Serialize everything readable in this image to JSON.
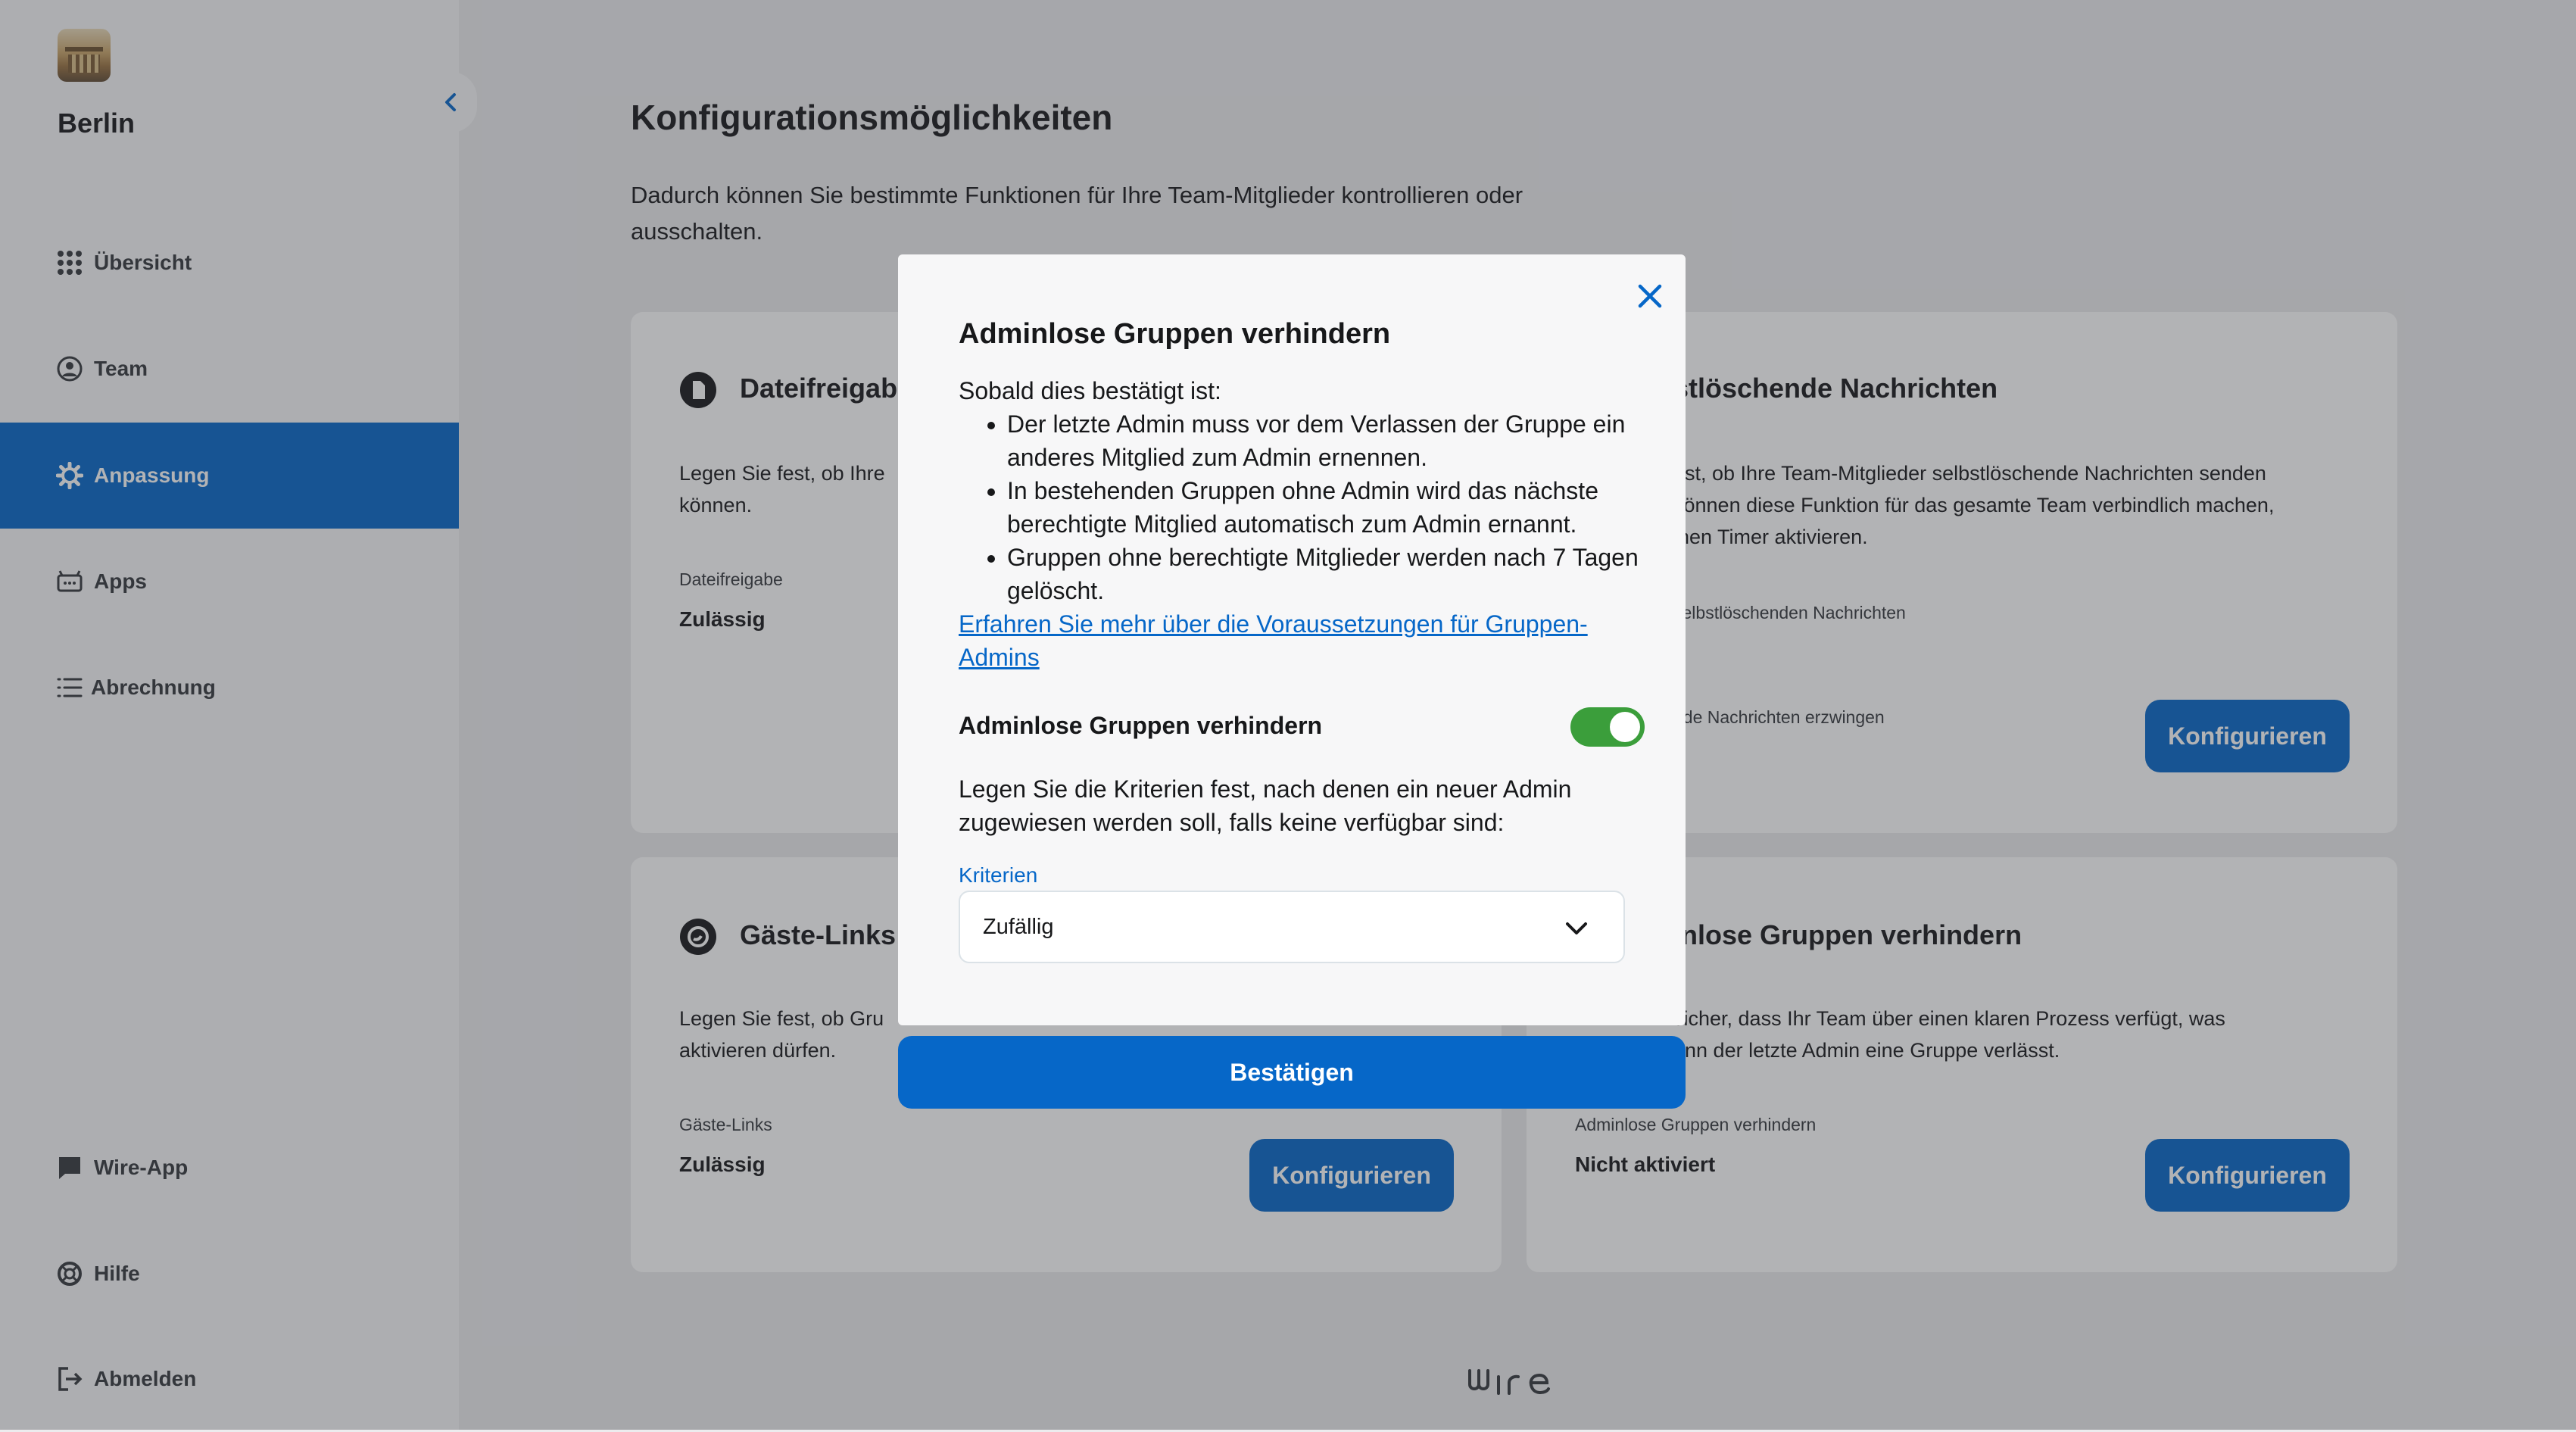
{
  "sidebar": {
    "team_name": "Berlin",
    "nav": [
      {
        "label": "Übersicht",
        "icon": "grid-icon"
      },
      {
        "label": "Team",
        "icon": "user-circle-icon"
      },
      {
        "label": "Anpassung",
        "icon": "gear-icon",
        "active": true
      },
      {
        "label": "Apps",
        "icon": "apps-icon"
      },
      {
        "label": "Abrechnung",
        "icon": "list-icon"
      }
    ],
    "bottom": [
      {
        "label": "Wire-App",
        "icon": "chat-icon"
      },
      {
        "label": "Hilfe",
        "icon": "help-icon"
      },
      {
        "label": "Abmelden",
        "icon": "logout-icon"
      }
    ]
  },
  "main": {
    "title": "Konfigurationsmöglichkeiten",
    "description": "Dadurch können Sie bestimmte Funktionen für Ihre Team-Mitglieder kontrollieren oder ausschalten.",
    "cards": [
      {
        "title": "Dateifreigab",
        "desc_line1": "Legen Sie fest, ob Ihre",
        "desc_line2": "können.",
        "label": "Dateifreigabe",
        "value": "Zulässig"
      },
      {
        "title": "stlöschende Nachrichten",
        "desc_line1": "est, ob Ihre Team-Mitglieder selbstlöschende Nachrichten senden",
        "desc_line2": "können diese Funktion für das gesamte Team verbindlich machen,",
        "desc_line3": "inen Timer aktivieren.",
        "label": "selbstlöschenden Nachrichten",
        "label2": "nde Nachrichten erzwingen",
        "button": "Konfigurieren"
      },
      {
        "title": "Gäste-Links",
        "desc_line1": "Legen Sie fest, ob Gru",
        "desc_line2": "aktivieren dürfen.",
        "label": "Gäste-Links",
        "value": "Zulässig",
        "button": "Konfigurieren"
      },
      {
        "title": "inlose Gruppen verhindern",
        "desc_line1": "sicher, dass Ihr Team über einen klaren Prozess verfügt, was",
        "desc_line2": "enn der letzte Admin eine Gruppe verlässt.",
        "label": "Adminlose Gruppen verhindern",
        "value": "Nicht aktiviert",
        "button": "Konfigurieren"
      }
    ]
  },
  "modal": {
    "title": "Adminlose Gruppen verhindern",
    "intro": "Sobald dies bestätigt ist:",
    "bullets": [
      "Der letzte Admin muss vor dem Verlassen der Gruppe ein anderes Mitglied zum Admin ernennen.",
      "In bestehenden Gruppen ohne Admin wird das nächste berechtigte Mitglied automatisch zum Admin ernannt.",
      "Gruppen ohne berechtigte Mitglieder werden nach 7 Tagen gelöscht."
    ],
    "link": "Erfahren Sie mehr über die Voraussetzungen für Gruppen-Admins",
    "toggle_label": "Adminlose Gruppen verhindern",
    "toggle_on": true,
    "criteria_desc": "Legen Sie die Kriterien fest, nach denen ein neuer Admin zugewiesen werden soll, falls keine verfügbar sind:",
    "criteria_label": "Kriterien",
    "criteria_value": "Zufällig",
    "confirm": "Bestätigen"
  },
  "colors": {
    "accent": "#0667c8",
    "toggle_on": "#3b9e3b",
    "sidebar_bg": "#f7f7f8",
    "page_bg": "#ececee"
  }
}
